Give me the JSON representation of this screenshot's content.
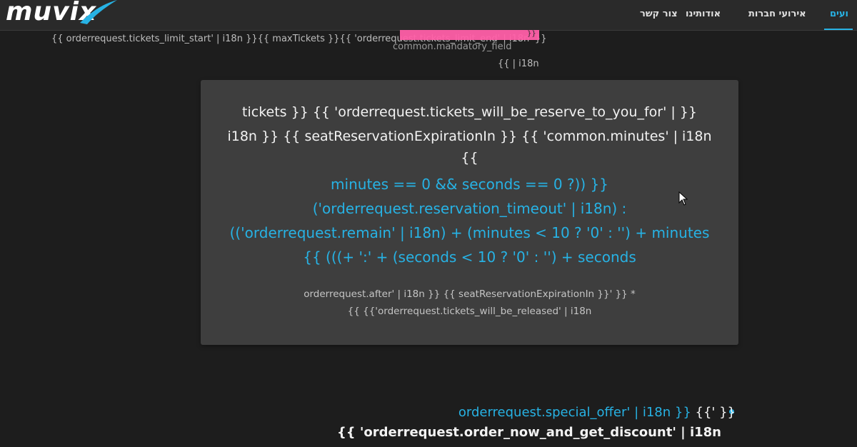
{
  "header": {
    "logo_text": "muvix",
    "nav": [
      {
        "label": "צור קשר",
        "active": false
      },
      {
        "label": "אודותינו",
        "active": false
      },
      {
        "label": "אירועי חברות",
        "active": false
      },
      {
        "label": "ועים",
        "active": true
      }
    ]
  },
  "template_text": {
    "limit_line": "{{ orderrequest.tickets_limit_start' | i18n }}{{ maxTickets }}{{ 'orderrequest.tickets_limit_end' | i18n' }}",
    "pink_overlay": "}}",
    "mandatory": "common.mandatory_field",
    "i18n_small": "{{ | i18n"
  },
  "card": {
    "line1": "tickets }} {{ 'orderrequest.tickets_will_be_reserve_to_you_for' | }}",
    "line2": "i18n }} {{ seatReservationExpirationIn }} {{ 'common.minutes' | i18n",
    "line3": "{{",
    "blue1": "minutes == 0 && seconds == 0 ?)) }}",
    "blue2": "('orderrequest.reservation_timeout' | i18n) :",
    "blue3": "(('orderrequest.remain' | i18n) + (minutes < 10 ? '0' : '') + minutes",
    "blue4": "{{ (((+ ':' + (seconds < 10 ? '0' : '') + seconds",
    "small1": "orderrequest.after' | i18n }} {{ seatReservationExpirationIn }}' }} *",
    "small2": "{{ {{'orderrequest.tickets_will_be_released' | i18n"
  },
  "offer": {
    "special_offer": "orderrequest.special_offer' | i18n }} ",
    "special_offer_tail": "{{' }}",
    "discount": "{{ 'orderrequest.order_now_and_get_discount' | i18n"
  },
  "colors": {
    "accent": "#27b2e4",
    "background": "#1d1d1d",
    "card": "#3e3e3e",
    "pink_highlight": "#ff5fa8"
  }
}
